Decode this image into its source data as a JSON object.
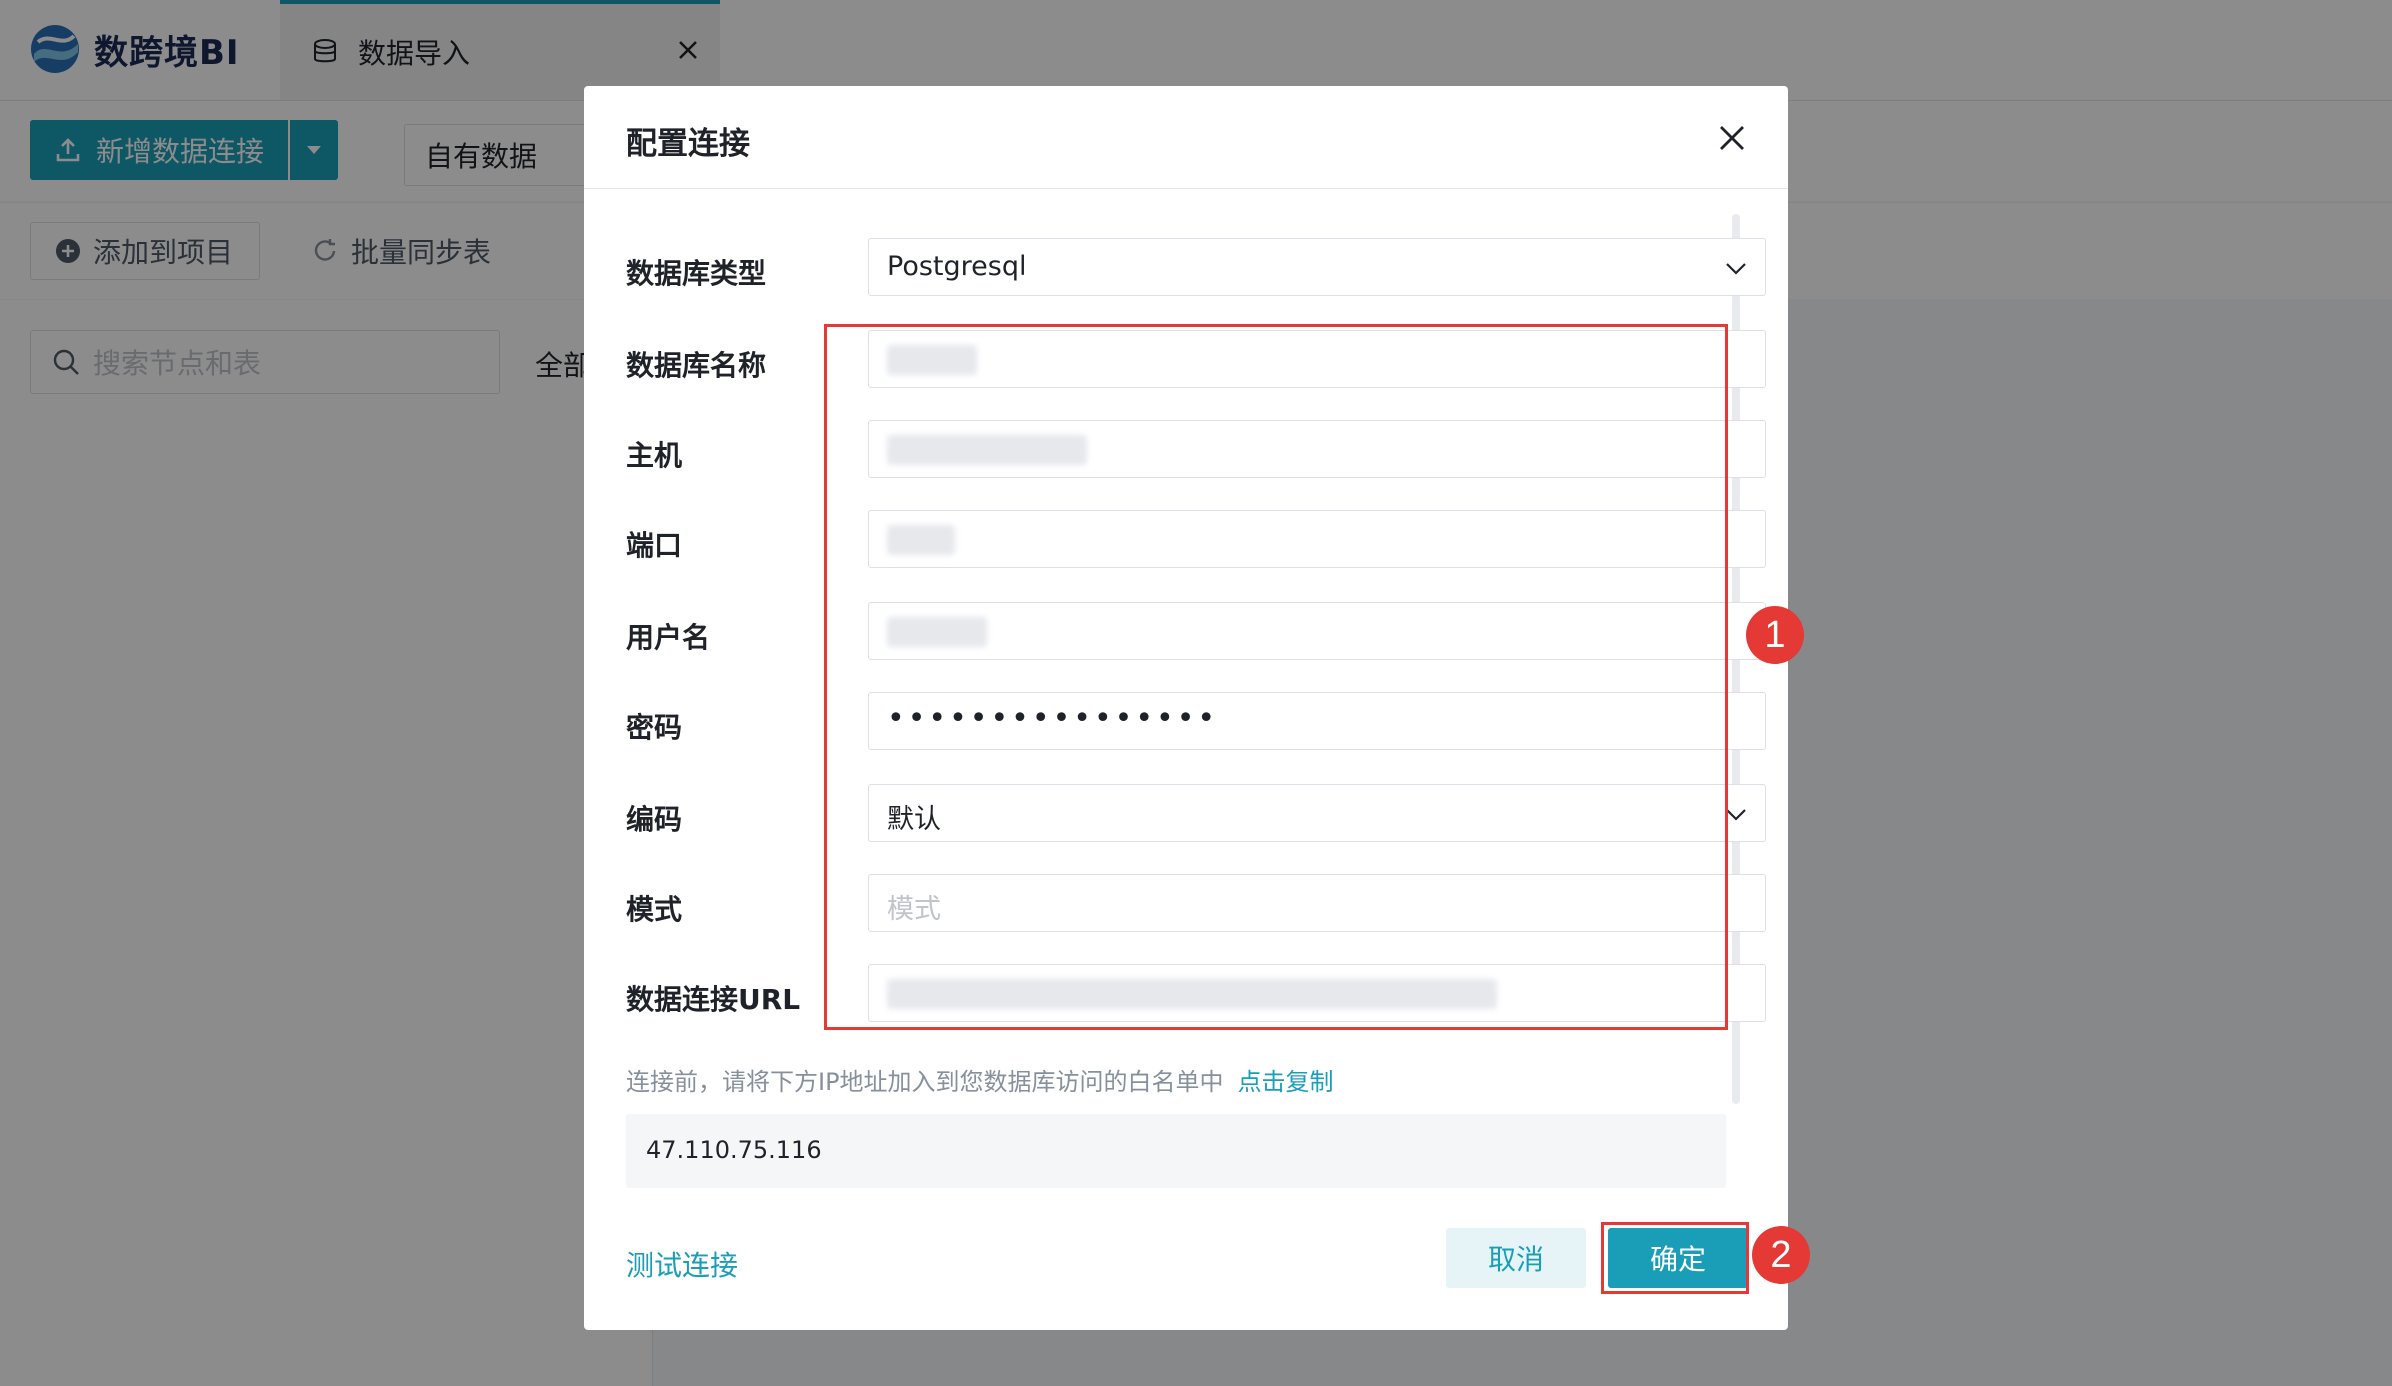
{
  "app": {
    "brand": "数跨境BI",
    "tab_label": "数据导入",
    "toolbar": {
      "new_connection": "新增数据连接",
      "own_data": "自有数据",
      "add_to_project": "添加到项目",
      "batch_sync": "批量同步表"
    },
    "search_placeholder": "搜索节点和表",
    "all_label": "全部"
  },
  "dialog": {
    "title": "配置连接",
    "fields": {
      "db_type": {
        "label": "数据库类型",
        "value": "Postgresql"
      },
      "db_name": {
        "label": "数据库名称"
      },
      "host": {
        "label": "主机"
      },
      "port": {
        "label": "端口"
      },
      "username": {
        "label": "用户名"
      },
      "password": {
        "label": "密码",
        "value": "••••••••••••••••"
      },
      "encoding": {
        "label": "编码",
        "value": "默认"
      },
      "schema": {
        "label": "模式",
        "placeholder": "模式"
      },
      "url": {
        "label": "数据连接URL"
      }
    },
    "hint": "连接前，请将下方IP地址加入到您数据库访问的白名单中",
    "copy_link": "点击复制",
    "ip": "47.110.75.116",
    "test_connection": "测试连接",
    "cancel": "取消",
    "confirm": "确定"
  },
  "annotations": {
    "badge1": "1",
    "badge2": "2"
  },
  "colors": {
    "accent": "#1a9eb8",
    "highlight": "#e53935"
  }
}
